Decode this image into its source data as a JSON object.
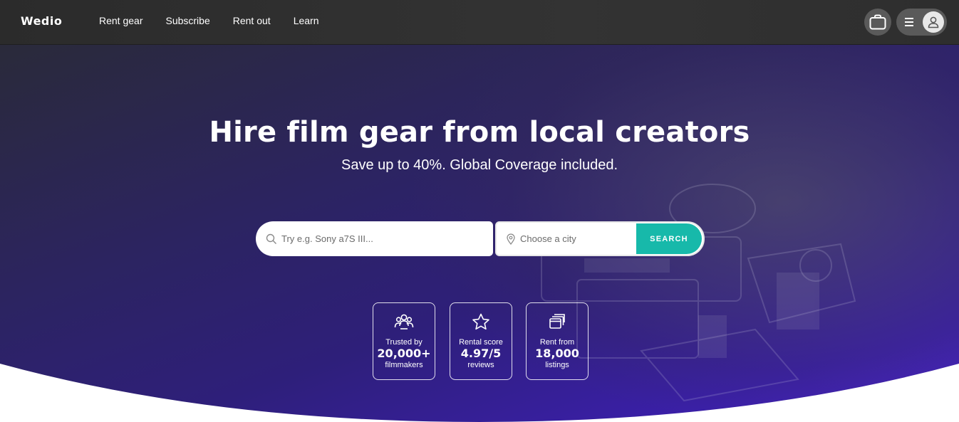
{
  "header": {
    "logo": "Wedio",
    "nav": [
      {
        "label": "Rent gear"
      },
      {
        "label": "Subscribe"
      },
      {
        "label": "Rent out"
      },
      {
        "label": "Learn"
      }
    ]
  },
  "hero": {
    "title": "Hire film gear from local creators",
    "subtitle": "Save up to 40%. Global Coverage included."
  },
  "search": {
    "gear_placeholder": "Try e.g. Sony a7S III...",
    "city_placeholder": "Choose a city",
    "button_label": "SEARCH"
  },
  "stats": [
    {
      "label": "Trusted by",
      "value": "20,000+",
      "sub": "filmmakers",
      "icon": "users-icon"
    },
    {
      "label": "Rental score",
      "value": "4.97/5",
      "sub": "reviews",
      "icon": "star-icon"
    },
    {
      "label": "Rent from",
      "value": "18,000",
      "sub": "listings",
      "icon": "listings-icon"
    }
  ],
  "colors": {
    "accent": "#17b9aa",
    "hero_purple": "#3a1fa8",
    "header_bg": "#2f2f2f"
  }
}
